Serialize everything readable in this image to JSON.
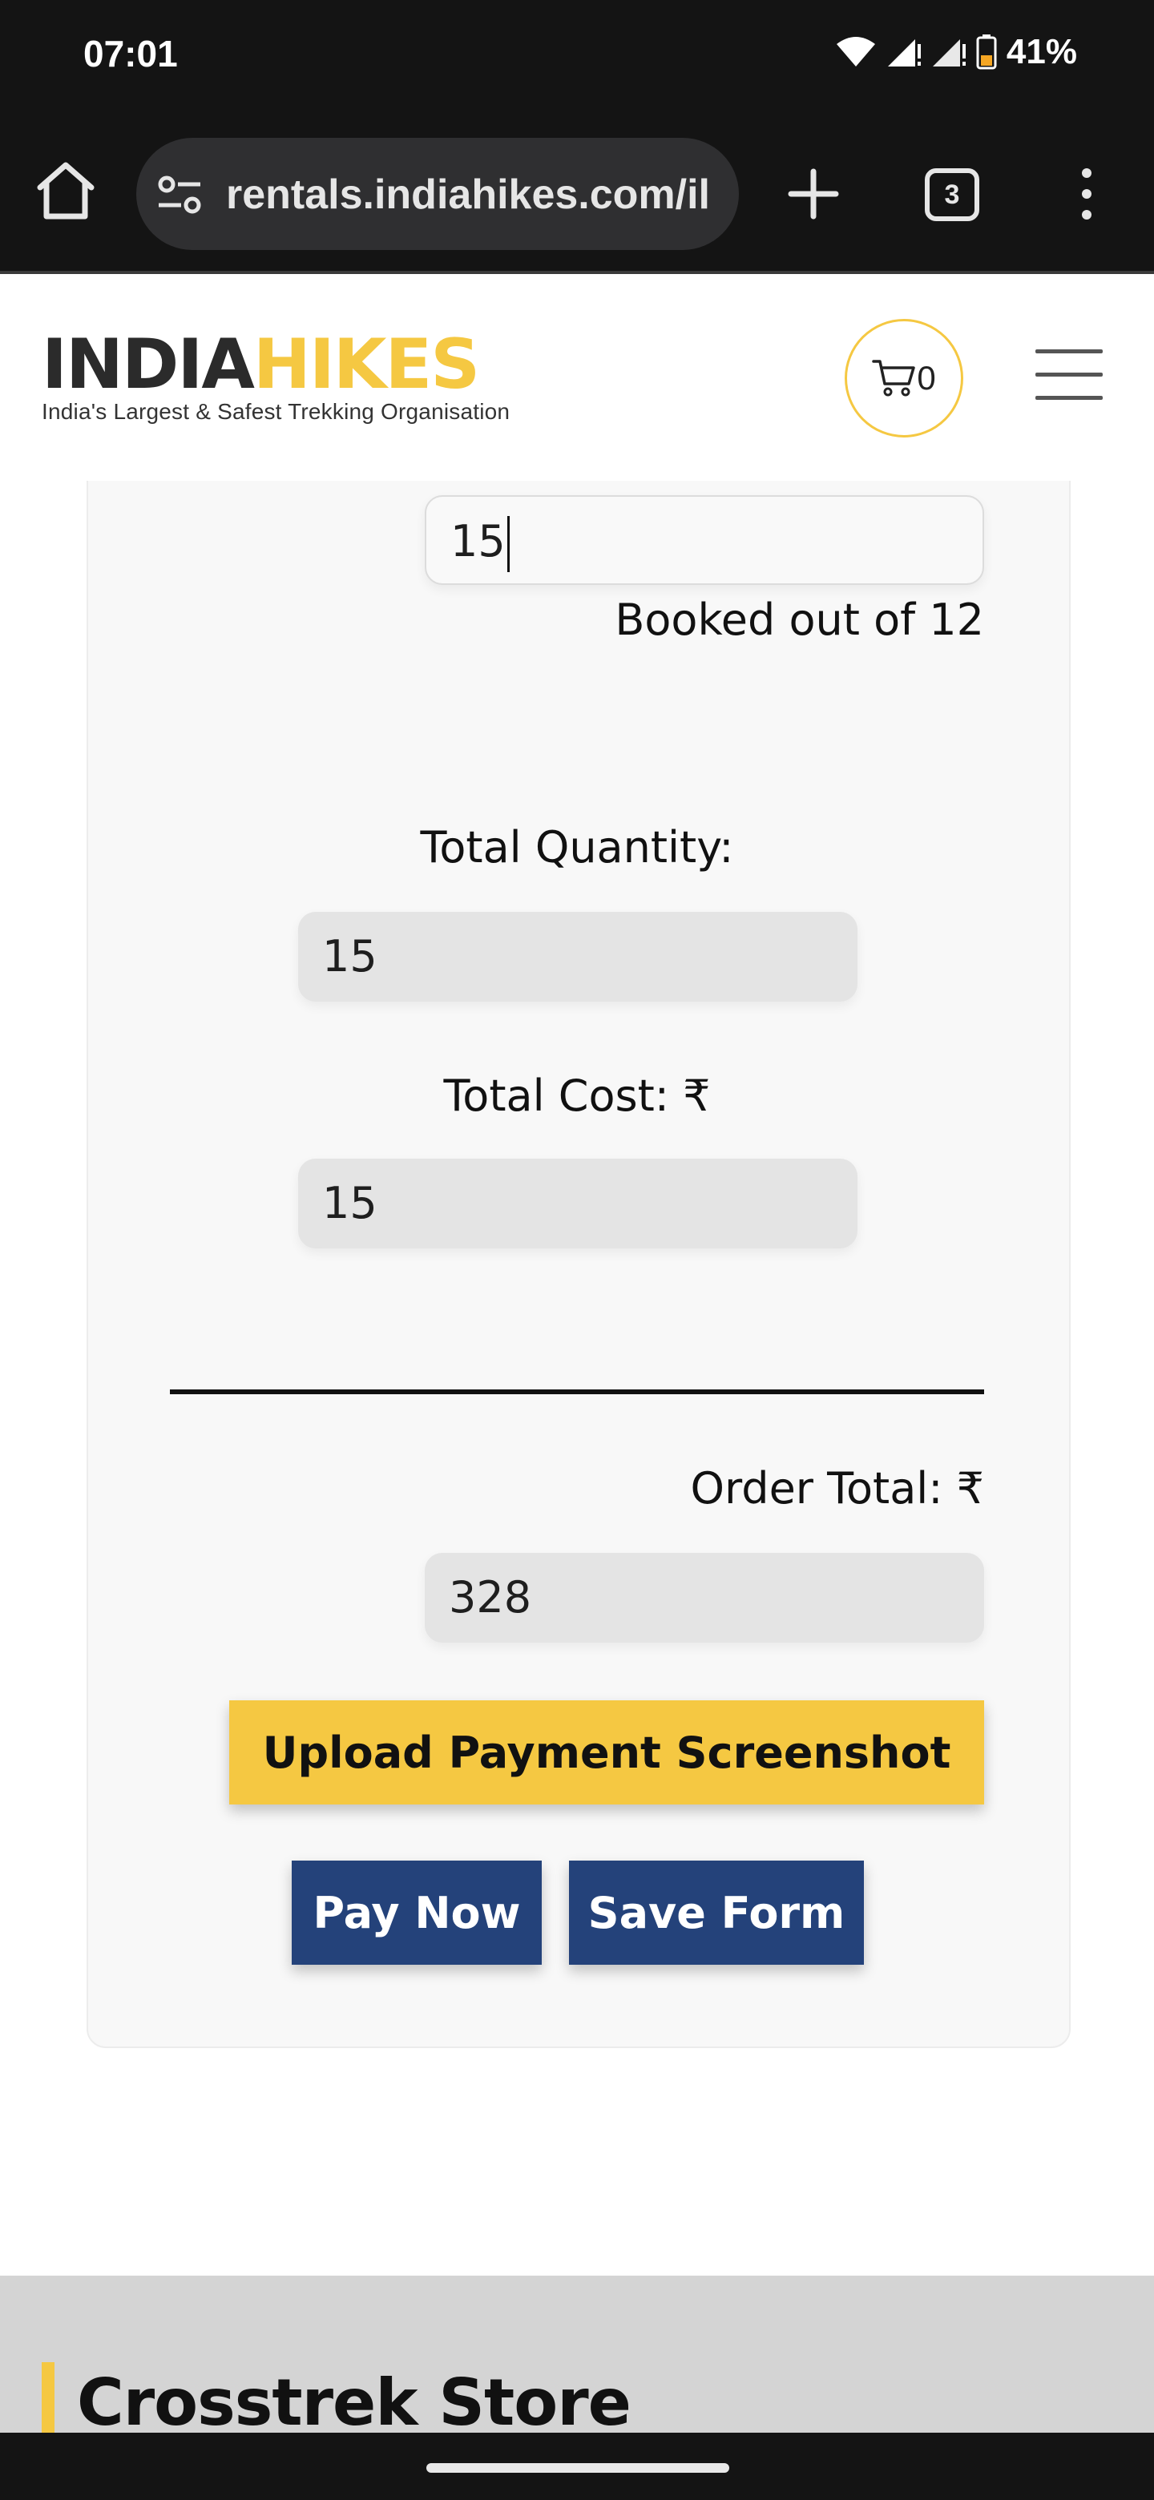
{
  "status_bar": {
    "time": "07:01",
    "battery_percent": "41%"
  },
  "browser": {
    "url": "rentals.indiahikes.com/il",
    "tab_count": "3"
  },
  "header": {
    "logo_part1": "INDIA",
    "logo_part2": "HIKES",
    "tagline": "India's Largest & Safest Trekking Organisation",
    "cart_count": "0"
  },
  "form": {
    "quantity_value": "15",
    "booked_text": "Booked out of 12",
    "total_quantity_label": "Total Quantity:",
    "total_quantity_value": "15",
    "total_cost_label": "Total Cost: ₹",
    "total_cost_value": "15",
    "order_total_label": "Order Total: ₹",
    "order_total_value": "328",
    "upload_button": "Upload Payment Screenshot",
    "pay_button": "Pay Now",
    "save_button": "Save Form"
  },
  "footer": {
    "store_title": "Crosstrek Store"
  },
  "colors": {
    "brand_yellow": "#f5c842",
    "button_navy": "#24427a",
    "chrome_dark": "#141414"
  }
}
